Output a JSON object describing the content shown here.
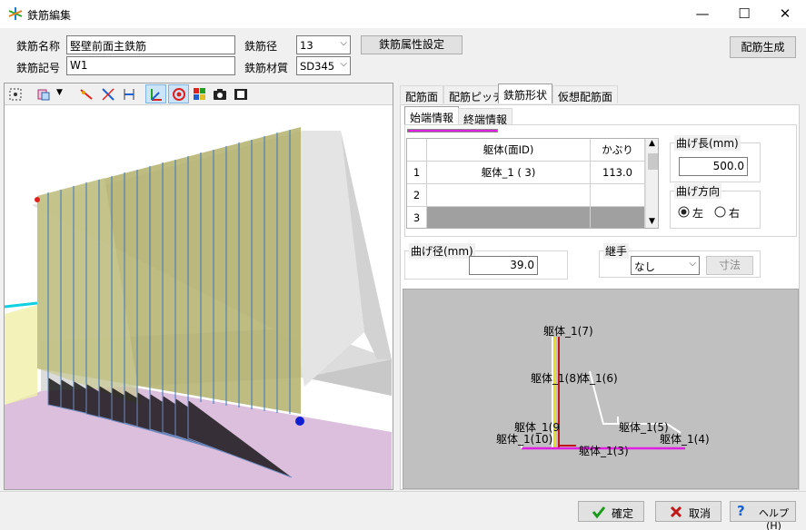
{
  "window": {
    "title": "鉄筋編集",
    "minimize": "—",
    "maximize": "☐",
    "close": "✕"
  },
  "header": {
    "name_label": "鉄筋名称",
    "name_value": "竪壁前面主鉄筋",
    "code_label": "鉄筋記号",
    "code_value": "W1",
    "diameter_label": "鉄筋径",
    "diameter_value": "13",
    "material_label": "鉄筋材質",
    "material_value": "SD345",
    "attr_button": "鉄筋属性設定",
    "generate_button": "配筋生成"
  },
  "tabs": [
    "配筋面",
    "配筋ピッチ",
    "鉄筋形状",
    "仮想配筋面"
  ],
  "active_tab": "鉄筋形状",
  "subtabs": [
    "始端情報",
    "終端情報"
  ],
  "active_subtab": "始端情報",
  "grid": {
    "headers": [
      "躯体(面ID)",
      "かぶり"
    ],
    "rows": [
      {
        "no": "1",
        "body": "躯体_1 ( 3)",
        "cover": "113.0"
      },
      {
        "no": "2",
        "body": "",
        "cover": ""
      },
      {
        "no": "3",
        "body": "",
        "cover": ""
      }
    ]
  },
  "bend_length": {
    "label": "曲げ長(mm)",
    "value": "500.0"
  },
  "bend_direction": {
    "label": "曲げ方向",
    "left": "左",
    "right": "右",
    "selected": "左"
  },
  "bend_radius": {
    "label": "曲げ径(mm)",
    "value": "39.0"
  },
  "joint": {
    "label": "継手",
    "value": "なし",
    "dim_button": "寸法"
  },
  "drawing_labels": {
    "l7": "躯体_1(7)",
    "l8": "躯体_1(8)",
    "l6": "体_1(6)",
    "l9": "躯体_1(9",
    "l10": "躯体_1(10)",
    "l5": "躯体_1(5)",
    "l4": "躯体_1(4)",
    "l3": "躯体_1(3)"
  },
  "footer": {
    "ok": "確定",
    "cancel": "取消",
    "help": "ヘルプ(H)"
  },
  "colors": {
    "accent": "#e020e0",
    "ok_check": "#1a9a1a",
    "cancel_x": "#c01818",
    "help_q": "#1a5fd0"
  }
}
